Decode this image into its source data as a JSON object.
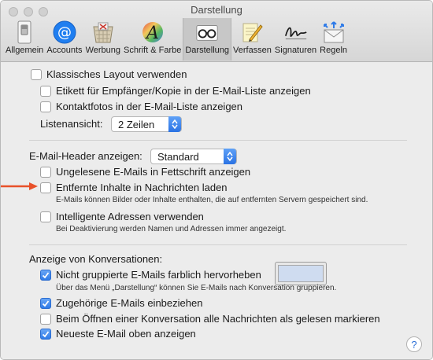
{
  "window": {
    "title": "Darstellung"
  },
  "toolbar": {
    "items": [
      {
        "label": "Allgemein",
        "icon": "switch-icon"
      },
      {
        "label": "Accounts",
        "icon": "at-sign-icon"
      },
      {
        "label": "Werbung",
        "icon": "junk-basket-icon"
      },
      {
        "label": "Schrift & Farbe",
        "icon": "font-color-icon"
      },
      {
        "label": "Darstellung",
        "icon": "glasses-icon",
        "selected": true
      },
      {
        "label": "Verfassen",
        "icon": "pencil-icon"
      },
      {
        "label": "Signaturen",
        "icon": "signature-icon"
      },
      {
        "label": "Regeln",
        "icon": "envelope-rules-icon"
      }
    ]
  },
  "list": {
    "classic_layout": {
      "label": "Klassisches Layout verwenden",
      "checked": false
    },
    "show_cc_label": {
      "label": "Etikett für Empfänger/Kopie in der E-Mail-Liste anzeigen",
      "checked": false
    },
    "show_contact_photos": {
      "label": "Kontaktfotos in der E-Mail-Liste anzeigen",
      "checked": false
    },
    "list_preview_label": "Listenansicht:",
    "list_preview_value": "2 Zeilen"
  },
  "header": {
    "label": "E-Mail-Header anzeigen:",
    "value": "Standard",
    "bold_unread": {
      "label": "Ungelesene E-Mails in Fettschrift anzeigen",
      "checked": false
    },
    "load_remote": {
      "label": "Entfernte Inhalte in Nachrichten laden",
      "checked": false,
      "note": "E-Mails können Bilder oder Inhalte enthalten, die auf entfernten Servern gespeichert sind."
    },
    "smart_addresses": {
      "label": "Intelligente Adressen verwenden",
      "checked": false,
      "note": "Bei Deaktivierung werden Namen und Adressen immer angezeigt."
    }
  },
  "conversations": {
    "heading": "Anzeige von Konversationen:",
    "highlight_ungrouped": {
      "label": "Nicht gruppierte E-Mails farblich hervorheben",
      "checked": true,
      "note": "Über das Menü „Darstellung“ können Sie E-Mails nach Konversation gruppieren.",
      "color": "#cfdcf0"
    },
    "include_related": {
      "label": "Zugehörige E-Mails einbeziehen",
      "checked": true
    },
    "mark_all_read": {
      "label": "Beim Öffnen einer Konversation alle Nachrichten als gelesen markieren",
      "checked": false
    },
    "newest_on_top": {
      "label": "Neueste E-Mail oben anzeigen",
      "checked": true
    }
  },
  "help": {
    "label": "?"
  },
  "colors": {
    "accent": "#2f7be8",
    "arrow": "#e8512a"
  }
}
